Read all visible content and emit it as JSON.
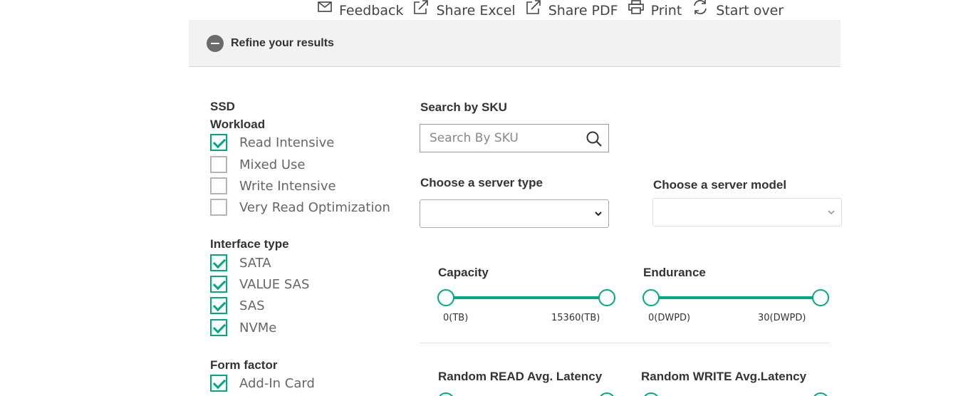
{
  "toolbar": {
    "feedback": "Feedback",
    "share_excel": "Share Excel",
    "share_pdf": "Share PDF",
    "print": "Print",
    "start_over": "Start over"
  },
  "refine": {
    "title": "Refine your results"
  },
  "filters": {
    "category": "SSD",
    "workload": {
      "title": "Workload",
      "items": [
        {
          "label": "Read Intensive",
          "checked": true
        },
        {
          "label": "Mixed Use",
          "checked": false
        },
        {
          "label": "Write Intensive",
          "checked": false
        },
        {
          "label": "Very Read Optimization",
          "checked": false
        }
      ]
    },
    "interface": {
      "title": "Interface type",
      "items": [
        {
          "label": "SATA",
          "checked": true
        },
        {
          "label": "VALUE SAS",
          "checked": true
        },
        {
          "label": "SAS",
          "checked": true
        },
        {
          "label": "NVMe",
          "checked": true
        }
      ]
    },
    "form_factor": {
      "title": "Form factor",
      "items": [
        {
          "label": "Add-In Card",
          "checked": true
        }
      ]
    }
  },
  "sku": {
    "label": "Search by SKU",
    "placeholder": "Search By SKU",
    "value": ""
  },
  "server_type": {
    "label": "Choose a server type",
    "selected": ""
  },
  "server_model": {
    "label": "Choose a server model",
    "selected": ""
  },
  "sliders": {
    "capacity": {
      "title": "Capacity",
      "min_label": "0(TB)",
      "max_label": "15360(TB)"
    },
    "endurance": {
      "title": "Endurance",
      "min_label": "0(DWPD)",
      "max_label": "30(DWPD)"
    },
    "read_latency": {
      "title": "Random READ Avg. Latency"
    },
    "write_latency": {
      "title": "Random WRITE Avg.Latency"
    }
  },
  "colors": {
    "accent": "#01a982",
    "refine_bg": "#f2f2f2"
  },
  "icons": {
    "feedback": "mail-icon",
    "share_excel": "external-link-icon",
    "share_pdf": "external-link-icon",
    "print": "printer-icon",
    "start_over": "refresh-icon"
  }
}
